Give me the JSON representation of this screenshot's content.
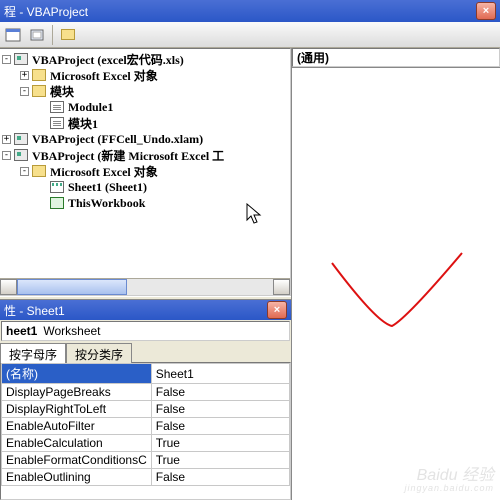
{
  "titlebar": {
    "text": "程 - VBAProject"
  },
  "code_pane": {
    "left_dropdown": "(通用)"
  },
  "tree": [
    {
      "lvl": 0,
      "exp": "-",
      "icon": "proj",
      "label": "VBAProject (excel宏代码.xls)"
    },
    {
      "lvl": 1,
      "exp": "+",
      "icon": "folder",
      "label": "Microsoft Excel 对象"
    },
    {
      "lvl": 1,
      "exp": "-",
      "icon": "folder",
      "label": "模块"
    },
    {
      "lvl": 2,
      "exp": "",
      "icon": "module",
      "label": "Module1"
    },
    {
      "lvl": 2,
      "exp": "",
      "icon": "module",
      "label": "模块1"
    },
    {
      "lvl": 0,
      "exp": "+",
      "icon": "proj",
      "label": "VBAProject (FFCell_Undo.xlam)"
    },
    {
      "lvl": 0,
      "exp": "-",
      "icon": "proj",
      "label": "VBAProject (新建 Microsoft Excel 工"
    },
    {
      "lvl": 1,
      "exp": "-",
      "icon": "folder",
      "label": "Microsoft Excel 对象"
    },
    {
      "lvl": 2,
      "exp": "",
      "icon": "sheet",
      "label": "Sheet1 (Sheet1)"
    },
    {
      "lvl": 2,
      "exp": "",
      "icon": "wb",
      "label": "ThisWorkbook"
    }
  ],
  "props": {
    "title": "性 - Sheet1",
    "obj_name": "heet1",
    "obj_type": "Worksheet",
    "tab_alpha": "按字母序",
    "tab_cat": "按分类序",
    "rows": [
      {
        "name": "(名称)",
        "value": "Sheet1",
        "sel": true
      },
      {
        "name": "DisplayPageBreaks",
        "value": "False"
      },
      {
        "name": "DisplayRightToLeft",
        "value": "False"
      },
      {
        "name": "EnableAutoFilter",
        "value": "False"
      },
      {
        "name": "EnableCalculation",
        "value": "True"
      },
      {
        "name": "EnableFormatConditionsC",
        "value": "True"
      },
      {
        "name": "EnableOutlining",
        "value": "False"
      }
    ]
  },
  "watermark": {
    "brand": "Baidu 经验",
    "url": "jingyan.baidu.com"
  }
}
